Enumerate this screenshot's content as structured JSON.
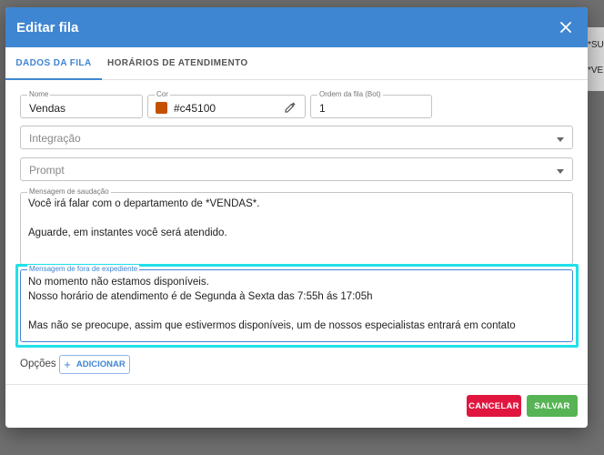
{
  "background": {
    "row1": "*SU",
    "row2": "*VE"
  },
  "dialog": {
    "title": "Editar fila",
    "close_icon": "close-icon",
    "tabs": [
      {
        "label": "DADOS DA FILA",
        "active": true
      },
      {
        "label": "HORÁRIOS DE ATENDIMENTO",
        "active": false
      }
    ],
    "fields": {
      "nome": {
        "label": "Nome",
        "value": "Vendas"
      },
      "cor": {
        "label": "Cor",
        "value": "#c45100",
        "swatch": "#c45100"
      },
      "ordem": {
        "label": "Ordem da fila (Bot)",
        "value": "1"
      },
      "integracao": {
        "placeholder": "Integração"
      },
      "prompt": {
        "placeholder": "Prompt"
      },
      "saudacao": {
        "label": "Mensagem de saudação",
        "value": "Você irá falar com o departamento de *VENDAS*.\n\nAguarde, em instantes você será atendido."
      },
      "fora_expediente": {
        "label": "Mensagem de fora de expediente",
        "value": "No momento não estamos disponíveis.\nNosso horário de atendimento é de Segunda à Sexta das 7:55h ás 17:05h\n\nMas não se preocupe, assim que estivermos disponíveis, um de nossos especialistas entrará em contato"
      }
    },
    "opcoes": {
      "label": "Opções",
      "add_label": "ADICIONAR"
    },
    "footer": {
      "cancel_label": "CANCELAR",
      "save_label": "SALVAR"
    }
  },
  "colors": {
    "primary": "#3f86d2",
    "cancel": "#e0163f",
    "save": "#56b455",
    "highlight": "#22e0e8"
  }
}
